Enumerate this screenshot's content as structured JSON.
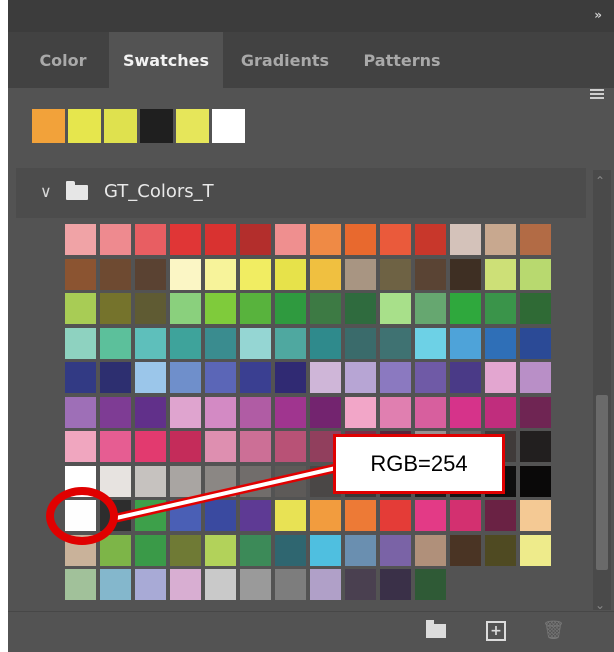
{
  "panel": {
    "collapse_label": "»",
    "tabs": [
      {
        "label": "Color",
        "active": false
      },
      {
        "label": "Swatches",
        "active": true
      },
      {
        "label": "Gradients",
        "active": false
      },
      {
        "label": "Patterns",
        "active": false
      }
    ],
    "menu_icon": "hamburger-menu-icon"
  },
  "recent_swatches": [
    "#f2a23a",
    "#e6e64d",
    "#dfe14e",
    "#1f1f1f",
    "#e6e65a",
    "#ffffff"
  ],
  "folder": {
    "name": "GT_Colors_T",
    "expanded": true,
    "chevron_icon": "chevron-down-icon",
    "folder_icon": "folder-icon"
  },
  "swatch_grid": [
    [
      "#f0a3a6",
      "#ee8a8f",
      "#e85e62",
      "#e03636",
      "#d93230",
      "#b32e2c",
      "#ef8f8f",
      "#ef8a45",
      "#e8692e",
      "#ea5a3b",
      "#c8372b",
      "#d4c2ba",
      "#c8a88f",
      "#b26b45"
    ],
    [
      "#8b5431",
      "#6e4a31",
      "#5a4232",
      "#fbf6c5",
      "#f7f39a",
      "#f1ed62",
      "#e7e24a",
      "#f0c040",
      "#a89582",
      "#6e6244",
      "#5a4434",
      "#3e2f23",
      "#cde077",
      "#b8d96f"
    ],
    [
      "#a8cc55",
      "#75732c",
      "#5f5b33",
      "#8ad07d",
      "#7fcb3b",
      "#58b33d",
      "#2f9a3f",
      "#3d7a44",
      "#2f6b3e",
      "#a8e08a",
      "#66a770",
      "#2fa83d",
      "#3a944a",
      "#2f6a35"
    ],
    [
      "#8ed2c0",
      "#5cc09b",
      "#5ebfbb",
      "#3ea39b",
      "#3a8c8f",
      "#95d6d3",
      "#4fa8a0",
      "#2f8a8c",
      "#3a6b6b",
      "#3f7272",
      "#6dd1e6",
      "#4ea3d9",
      "#2f6fb7",
      "#2b4a96"
    ],
    [
      "#323a84",
      "#2d2f70",
      "#9bc6ea",
      "#6f8fcb",
      "#5b66b7",
      "#3a3f91",
      "#302a73",
      "#cfb6d8",
      "#b7a5d4",
      "#8b79c0",
      "#6f5aa6",
      "#4a3a87",
      "#e3a6d0",
      "#b98fc7"
    ],
    [
      "#9e6fb7",
      "#7e3c94",
      "#61308a",
      "#dfa4cf",
      "#d38ac4",
      "#b05ca4",
      "#a0358f",
      "#73246f",
      "#f2a6c8",
      "#e07fb0",
      "#d75f9e",
      "#d6338a",
      "#c02d7d",
      "#6f2553"
    ],
    [
      "#f0a6bf",
      "#e65d92",
      "#e23a6f",
      "#c42c5a",
      "#de8fb0",
      "#cc6f96",
      "#b85276",
      "#913f5d",
      "#7e2c45",
      "#5b243a",
      "#9a9090",
      "#6a6463",
      "#403b3a",
      "#221f1f"
    ],
    [
      "#ffffff",
      "#e7e3e0",
      "#c6c2bf",
      "#a9a5a2",
      "#8b8784",
      "#716d6b",
      "#5d5a58",
      "#4a4746",
      "#3a3837",
      "#2c2a2a",
      "#1f1d1d",
      "#161414",
      "#0f0e0e",
      "#0a0909"
    ],
    [
      "#fefefe",
      "#2d2d2d",
      "#3da04a",
      "#4a5fb5",
      "#3a4aa0",
      "#5e3a94",
      "#e8e254",
      "#f29c3e",
      "#ed7a36",
      "#e43c37",
      "#e33a86",
      "#d33070",
      "#6a2244",
      "#f4c994"
    ],
    [
      "#c9b29a",
      "#7db548",
      "#3a9a48",
      "#6f7a35",
      "#b2d25a",
      "#3c8a58",
      "#2f6670",
      "#4fbfe0",
      "#6a8fb0",
      "#7a63a6",
      "#b0907a",
      "#4a3424",
      "#4f4a22",
      "#eeeb8b"
    ],
    [
      "#a1c19a",
      "#84b7cc",
      "#a8aad6",
      "#d8aed2",
      "#c9c9c9",
      "#9a9a9a",
      "#7d7d7d",
      "#b0a0c8",
      "#4a4050",
      "#3a3048",
      "#2f5a36"
    ]
  ],
  "callout": {
    "text": "RGB=254",
    "color": "#e00000"
  },
  "footer": {
    "new_group_icon": "folder-icon",
    "new_swatch_icon": "plus-square-icon",
    "delete_icon": "trash-icon"
  }
}
